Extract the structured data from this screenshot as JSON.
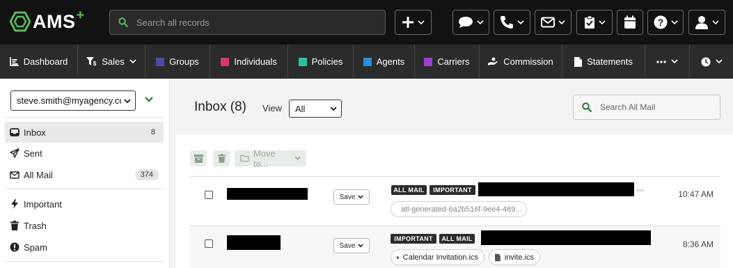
{
  "app": {
    "logo_text": "AMS",
    "logo_plus": "+"
  },
  "topbar": {
    "search_placeholder": "Search all records",
    "buttons": [
      {
        "name": "add-icon"
      },
      {
        "name": "chat-icon"
      },
      {
        "name": "phone-icon"
      },
      {
        "name": "mail-icon"
      },
      {
        "name": "clipboard-check-icon"
      },
      {
        "name": "calendar-icon"
      },
      {
        "name": "help-icon"
      },
      {
        "name": "user-icon"
      }
    ]
  },
  "nav": {
    "items": [
      {
        "label": "Dashboard",
        "icon": "chart-icon"
      },
      {
        "label": "Sales",
        "icon": "filter-dollar-icon",
        "dropdown": true
      },
      {
        "label": "Groups",
        "color": "#4b4ba8"
      },
      {
        "label": "Individuals",
        "color": "#d6386a"
      },
      {
        "label": "Policies",
        "color": "#2fc0a3"
      },
      {
        "label": "Agents",
        "color": "#2b8fd9"
      },
      {
        "label": "Carriers",
        "color": "#9b3fd1"
      },
      {
        "label": "Commission",
        "icon": "hand-coin-icon"
      },
      {
        "label": "Statements",
        "icon": "document-icon"
      }
    ]
  },
  "sidebar": {
    "account": "steve.smith@myagency.co",
    "folders": [
      {
        "label": "Inbox",
        "count": "8",
        "icon": "inbox-icon"
      },
      {
        "label": "Sent",
        "count": "",
        "icon": "paper-plane-icon"
      },
      {
        "label": "All Mail",
        "count": "374",
        "icon": "envelope-icon"
      },
      {
        "label": "Important",
        "count": "",
        "icon": "bolt-icon"
      },
      {
        "label": "Trash",
        "count": "",
        "icon": "trash-icon"
      },
      {
        "label": "Spam",
        "count": "",
        "icon": "alert-circle-icon"
      }
    ]
  },
  "mail": {
    "title": "Inbox (8)",
    "view_label": "View",
    "view_value": "All",
    "search_placeholder": "Search All Mail",
    "move_to_label": "Move to...",
    "save_label": "Save",
    "messages": [
      {
        "tags": [
          "ALL MAIL",
          "IMPORTANT"
        ],
        "attachments": [
          "atl-generated-6a2b516f-9ee4-469..."
        ],
        "time": "10:47 AM",
        "ellipsis": "..."
      },
      {
        "tags": [
          "IMPORTANT",
          "ALL MAIL"
        ],
        "attachments": [
          "Calendar Invitation.ics",
          "invite.ics"
        ],
        "time": "8:36 AM"
      }
    ]
  },
  "colors": {
    "accent": "#5cb85c",
    "topbar": "#121212",
    "navbar": "#2b2b2b"
  }
}
